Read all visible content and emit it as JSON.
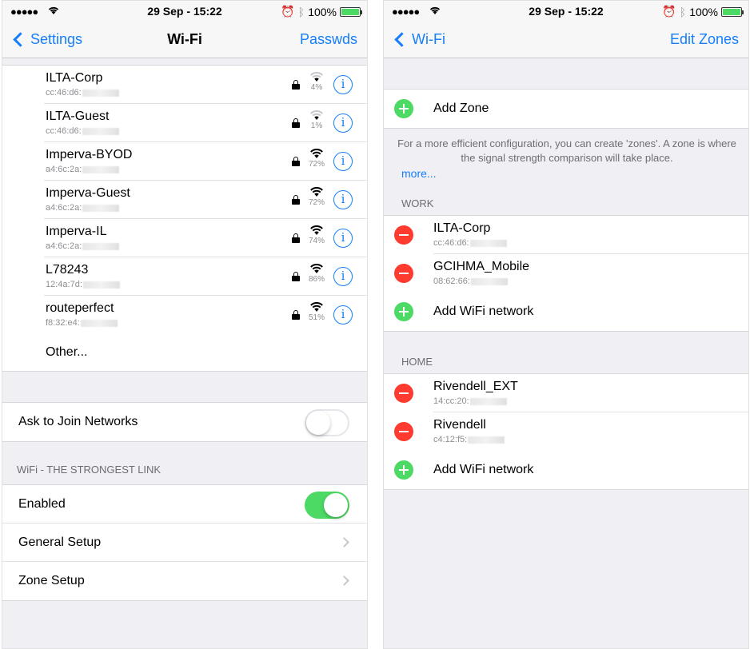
{
  "status": {
    "signal_dots": "●●●●●",
    "time": "29 Sep - 15:22",
    "battery": "100%"
  },
  "left": {
    "nav": {
      "back": "Settings",
      "title": "Wi-Fi",
      "right": "Passwds"
    },
    "networks": [
      {
        "name": "ILTA-Corp",
        "mac": "cc:46:d6:",
        "signal": "4%"
      },
      {
        "name": "ILTA-Guest",
        "mac": "cc:46:d6:",
        "signal": "1%"
      },
      {
        "name": "Imperva-BYOD",
        "mac": "a4:6c:2a:",
        "signal": "72%"
      },
      {
        "name": "Imperva-Guest",
        "mac": "a4:6c:2a:",
        "signal": "72%"
      },
      {
        "name": "Imperva-IL",
        "mac": "a4:6c:2a:",
        "signal": "74%"
      },
      {
        "name": "L78243",
        "mac": "12:4a:7d:",
        "signal": "86%"
      },
      {
        "name": "routeperfect",
        "mac": "f8:32:e4:",
        "signal": "51%"
      }
    ],
    "other": "Other...",
    "ask_to_join": "Ask to Join Networks",
    "section_header": "WiFi - THE STRONGEST LINK",
    "enabled": "Enabled",
    "general_setup": "General Setup",
    "zone_setup": "Zone Setup"
  },
  "right": {
    "nav": {
      "back": "Wi-Fi",
      "right": "Edit Zones"
    },
    "add_zone": "Add Zone",
    "footer": "For a more efficient configuration, you can create 'zones'. A zone is where the signal strength comparison will take place.",
    "more": "more...",
    "work_header": "WORK",
    "work_networks": [
      {
        "name": "ILTA-Corp",
        "mac": "cc:46:d6:"
      },
      {
        "name": "GCIHMA_Mobile",
        "mac": "08:62:66:"
      }
    ],
    "add_wifi": "Add WiFi network",
    "home_header": "HOME",
    "home_networks": [
      {
        "name": "Rivendell_EXT",
        "mac": "14:cc:20:"
      },
      {
        "name": "Rivendell",
        "mac": "c4:12:f5:"
      }
    ]
  },
  "colors": {
    "accent": "#157efb",
    "green": "#4cd964",
    "red": "#ff3b30"
  }
}
